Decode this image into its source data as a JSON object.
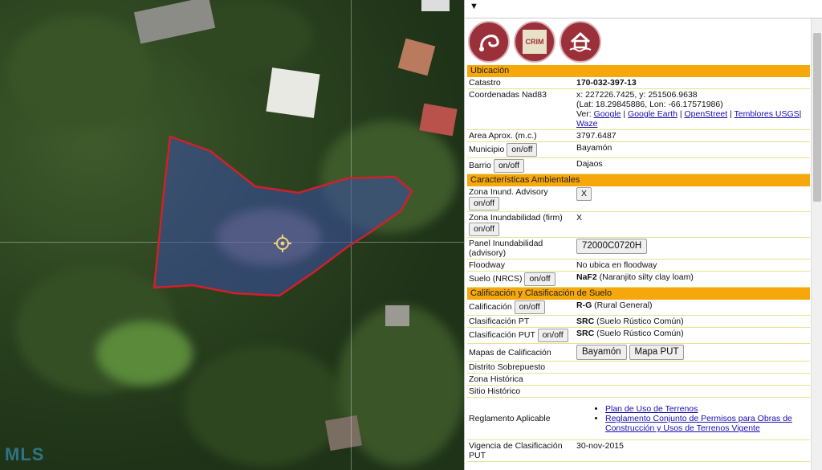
{
  "watermark": "MLS",
  "panel": {
    "sections": {
      "ubicacion": "Ubicación",
      "ambientales": "Características Ambientales",
      "calificacion": "Calificación y Clasificación de Suelo"
    },
    "logos": {
      "crim_text": "CRIM"
    },
    "ubicacion": {
      "catastro_label": "Catastro",
      "catastro_value": "170-032-397-13",
      "coords_label": "Coordenadas Nad83",
      "coords_xy": "x: 227226.7425, y: 251506.9638",
      "coords_latlon": "(Lat: 18.29845886, Lon: -66.17571986)",
      "ver_prefix": "Ver:",
      "links": [
        "Google",
        "Google Earth",
        "OpenStreet",
        "Temblores USGS",
        "Waze"
      ],
      "area_label": "Area Aprox. (m.c.)",
      "area_value": "3797.6487",
      "municipio_label": "Municipio",
      "municipio_value": "Bayamón",
      "barrio_label": "Barrio",
      "barrio_value": "Dajaos"
    },
    "ambientales": {
      "zona_adv_label": "Zona Inund. Advisory",
      "zona_adv_btn": "X",
      "zona_firm_label": "Zona Inundabilidad (firm)",
      "zona_firm_value": "X",
      "panel_label": "Panel Inundabilidad (advisory)",
      "panel_btn": "72000C0720H",
      "floodway_label": "Floodway",
      "floodway_value": "No ubica en floodway",
      "suelo_label": "Suelo (NRCS)",
      "suelo_code": "NaF2",
      "suelo_desc": "(Naranjito silty clay loam)"
    },
    "calificacion": {
      "calif_label": "Calificación",
      "calif_code": "R-G",
      "calif_desc": "(Rural General)",
      "clas_pt_label": "Clasificación PT",
      "clas_pt_code": "SRC",
      "clas_pt_desc": "(Suelo Rústico Común)",
      "clas_put_label": "Clasificación PUT",
      "clas_put_code": "SRC",
      "clas_put_desc": "(Suelo Rústico Común)",
      "mapas_label": "Mapas de Calificación",
      "mapas_btn1": "Bayamón",
      "mapas_btn2": "Mapa PUT",
      "distrito_label": "Distrito Sobrepuesto",
      "zona_hist_label": "Zona Histórica",
      "sitio_hist_label": "Sitio Histórico",
      "reglamento_label": "Reglamento Aplicable",
      "reglamento_links": [
        "Plan de Uso de Terrenos",
        "Reglamento Conjunto de Permisos para Obras de Construcción y Usos de Terrenos Vigente"
      ],
      "vigencia_label": "Vigencia de Clasificación PUT",
      "vigencia_value": "30-nov-2015"
    },
    "onoff_label": "on/off"
  },
  "colors": {
    "section_bg": "#f6a70b",
    "parcel_fill": "#3b4fa8",
    "parcel_stroke": "#d0202a",
    "logo": "#9b2f3a"
  }
}
